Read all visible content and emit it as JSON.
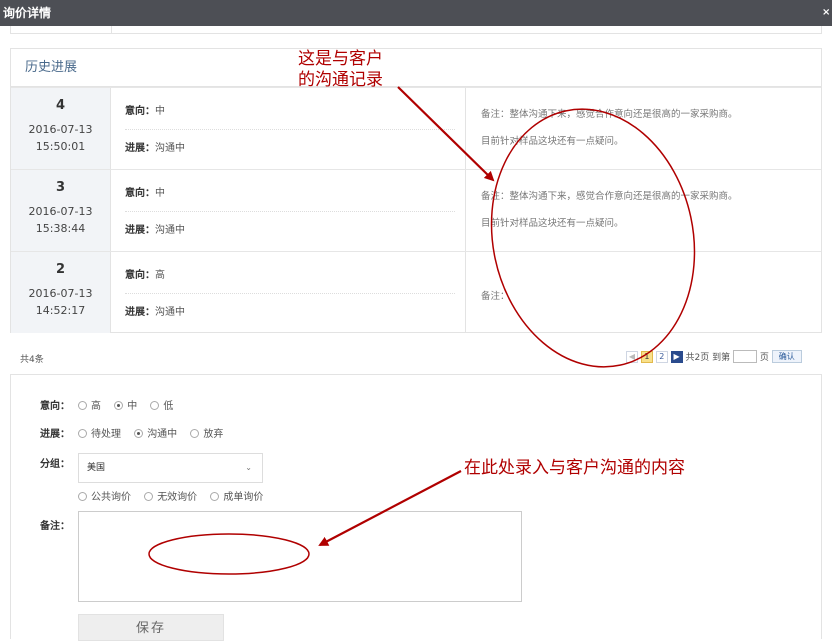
{
  "window": {
    "title": "询价详情",
    "close_glyph": "×"
  },
  "history": {
    "heading": "历史进展",
    "intent_label": "意向：",
    "progress_label": "进展：",
    "remark_label": "备注：",
    "rows": [
      {
        "num": "4",
        "date": "2016-07-13",
        "time": "15:50:01",
        "intent": "中",
        "progress": "沟通中",
        "remark_line1": "备注：整体沟通下来，感觉合作意向还是很高的一家采购商。",
        "remark_line2": "目前针对样品这块还有一点疑问。"
      },
      {
        "num": "3",
        "date": "2016-07-13",
        "time": "15:38:44",
        "intent": "中",
        "progress": "沟通中",
        "remark_line1": "备注：整体沟通下来，感觉合作意向还是很高的一家采购商。",
        "remark_line2": "目前针对样品这块还有一点疑问。"
      },
      {
        "num": "2",
        "date": "2016-07-13",
        "time": "14:52:17",
        "intent": "高",
        "progress": "沟通中",
        "remark_line1": "备注：",
        "remark_line2": ""
      }
    ]
  },
  "pagination": {
    "total_text": "共4条",
    "prev": "◀",
    "pages": [
      "1",
      "2"
    ],
    "next": "▶",
    "total_pages_text": "共2页",
    "goto_label": "到第",
    "page_suffix": "页",
    "confirm_label": "确认"
  },
  "form": {
    "intent_label": "意向：",
    "intent_options": [
      {
        "label": "高",
        "checked": false
      },
      {
        "label": "中",
        "checked": true
      },
      {
        "label": "低",
        "checked": false
      }
    ],
    "progress_label": "进展：",
    "progress_options": [
      {
        "label": "待处理",
        "checked": false
      },
      {
        "label": "沟通中",
        "checked": true
      },
      {
        "label": "放弃",
        "checked": false
      }
    ],
    "group_label": "分组：",
    "group_selected": "美国",
    "group_options": [
      {
        "label": "公共询价",
        "checked": false
      },
      {
        "label": "无效询价",
        "checked": false
      },
      {
        "label": "成单询价",
        "checked": false
      }
    ],
    "remark_label": "备注：",
    "remark_value": "",
    "save_label": "保存"
  },
  "annotations": {
    "note_top_line1": "这是与客户",
    "note_top_line2": "的沟通记录",
    "note_bottom": "在此处录入与客户沟通的内容",
    "color": "#b00000"
  },
  "colors": {
    "titlebar": "#4d4f55",
    "heading": "#4a6a8c",
    "page_current": "#f8e08a",
    "next_button": "#2a4b8d"
  }
}
